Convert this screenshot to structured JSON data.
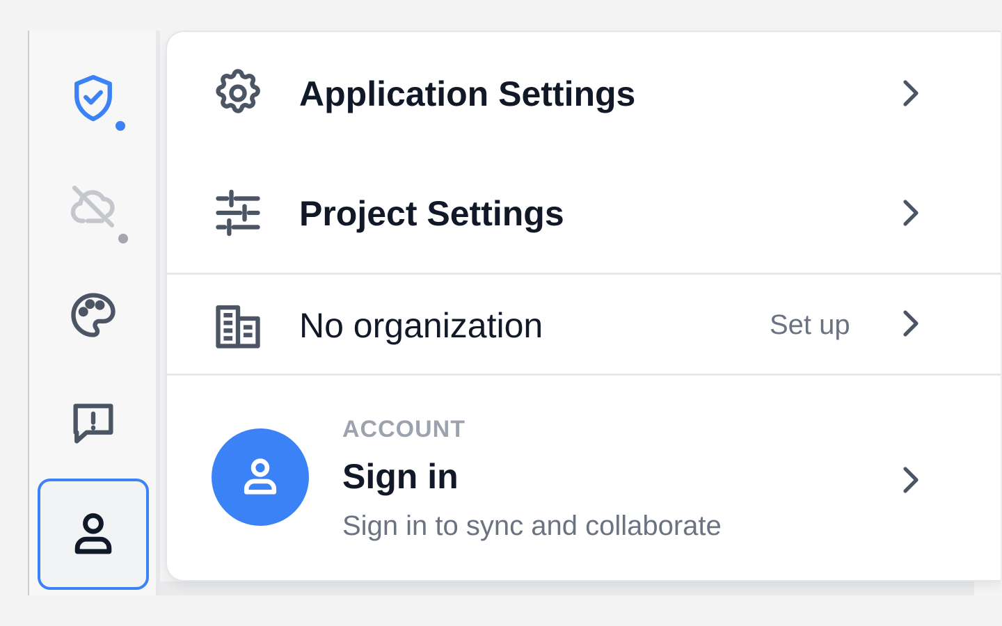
{
  "colors": {
    "accent": "#3b82f6",
    "text_primary": "#111827",
    "text_secondary": "#6b7280",
    "icon_gray": "#4b5563",
    "disabled_gray": "#c4c7cc"
  },
  "sidebar": {
    "items": [
      {
        "icon": "shield-check-icon",
        "status": "active-dot"
      },
      {
        "icon": "cloud-off-icon",
        "status": "inactive-dot"
      },
      {
        "icon": "palette-icon"
      },
      {
        "icon": "feedback-icon"
      },
      {
        "icon": "user-icon",
        "selected": true
      }
    ]
  },
  "menu": {
    "app_settings": {
      "label": "Application Settings",
      "icon": "gear-icon"
    },
    "project_settings": {
      "label": "Project Settings",
      "icon": "sliders-icon"
    },
    "organization": {
      "label": "No organization",
      "action": "Set up",
      "icon": "building-icon"
    },
    "account": {
      "caption": "ACCOUNT",
      "title": "Sign in",
      "subtitle": "Sign in to sync and collaborate",
      "icon": "user-avatar-icon"
    }
  }
}
